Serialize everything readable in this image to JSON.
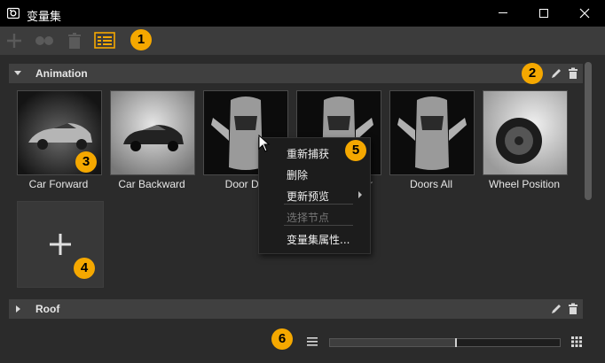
{
  "window": {
    "title": "变量集"
  },
  "callouts": [
    "1",
    "2",
    "3",
    "4",
    "5",
    "6"
  ],
  "sections": [
    {
      "name": "Animation",
      "expanded": true
    },
    {
      "name": "Roof",
      "expanded": false
    }
  ],
  "variants": [
    {
      "label": "Car Forward",
      "icon": "car-front-view"
    },
    {
      "label": "Car Backward",
      "icon": "car-rear-view"
    },
    {
      "label": "Door Dri",
      "icon": "car-top-view-doors-open"
    },
    {
      "label": "r",
      "icon": "car-top-view-doors-open"
    },
    {
      "label": "Doors All",
      "icon": "car-top-view-doors-open"
    },
    {
      "label": "Wheel Position",
      "icon": "car-wheel-closeup"
    }
  ],
  "context_menu": {
    "items": [
      {
        "label": "重新捕获",
        "enabled": true
      },
      {
        "label": "删除",
        "enabled": true
      },
      {
        "label": "更新预览",
        "enabled": true,
        "submenu": true
      },
      {
        "label": "选择节点",
        "enabled": false
      },
      {
        "label": "变量集属性...",
        "enabled": true
      }
    ]
  },
  "slider": {
    "value": 0.55
  },
  "colors": {
    "accent_badge": "#f5a800",
    "titlebar": "#000000",
    "toolbar": "#3c3c3c",
    "panel": "#2b2b2b",
    "header": "#404040"
  }
}
